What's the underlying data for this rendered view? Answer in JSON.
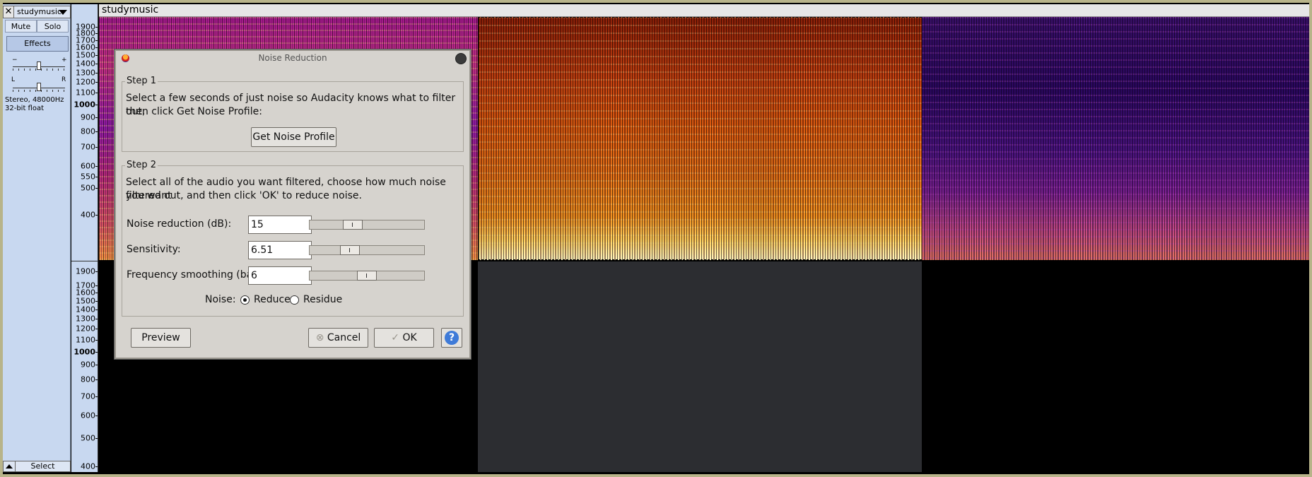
{
  "track": {
    "name": "studymusic",
    "close_glyph": "✕",
    "mute_label": "Mute",
    "solo_label": "Solo",
    "effects_label": "Effects",
    "gain_minus": "−",
    "gain_plus": "+",
    "pan_left": "L",
    "pan_right": "R",
    "gain_level": 0.5,
    "pan_level": 0.5,
    "info_line1": "Stereo, 48000Hz",
    "info_line2": "32-bit float",
    "select_label": "Select",
    "title": "studymusic"
  },
  "ruler": {
    "upper": [
      "1900",
      "1800",
      "1700",
      "1600",
      "1500",
      "1400",
      "1300",
      "1200",
      "1100",
      "1000",
      "900",
      "800",
      "700",
      "600",
      "550",
      "500",
      "400"
    ],
    "lower": [
      "1900",
      "1700",
      "1600",
      "1500",
      "1400",
      "1300",
      "1200",
      "1100",
      "1000",
      "900",
      "800",
      "700",
      "600",
      "500",
      "400"
    ],
    "bold_value": "1000"
  },
  "dialog": {
    "title": "Noise Reduction",
    "step1_title": "Step 1",
    "step1_text_line1": "Select a few seconds of just noise so Audacity knows what to filter out,",
    "step1_text_line2": "then click Get Noise Profile:",
    "get_profile_button": "Get Noise Profile",
    "step2_title": "Step 2",
    "step2_text_line1": "Select all of the audio you want filtered, choose how much noise you want",
    "step2_text_line2": "filtered out, and then click 'OK' to reduce noise.",
    "noise_reduction_label": "Noise reduction (dB):",
    "noise_reduction_value": "15",
    "sensitivity_label": "Sensitivity:",
    "sensitivity_value": "6.51",
    "frequency_smoothing_label": "Frequency smoothing (bands):",
    "frequency_smoothing_value": "6",
    "noise_label": "Noise:",
    "reduce_label": "Reduce",
    "residue_label": "Residue",
    "noise_mode_selected": "Reduce",
    "preview_button": "Preview",
    "cancel_button": "Cancel",
    "ok_button": "OK",
    "help_glyph": "?",
    "sliders": {
      "noise_reduction_level": 0.35,
      "sensitivity_level": 0.32,
      "frequency_smoothing_level": 0.5
    }
  },
  "colors": {
    "track_panel": "#c8d8f0",
    "dialog_bg": "#d6d3ce",
    "selection_bg": "#2c2d31",
    "help_blue": "#3f7bd8"
  }
}
